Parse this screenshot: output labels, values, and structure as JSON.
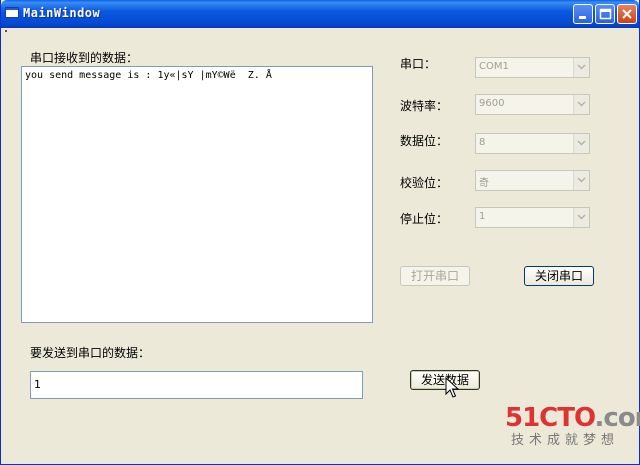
{
  "window": {
    "title": "MainWindow"
  },
  "receive": {
    "label": "串口接收到的数据：",
    "content": "you send message is : 1y«|sY |mY©Wë  Z. Å"
  },
  "send": {
    "label": "要发送到串口的数据：",
    "value": "1",
    "button": "发送数据"
  },
  "settings": [
    {
      "label": "串口：",
      "value": "COM1"
    },
    {
      "label": "波特率：",
      "value": "9600"
    },
    {
      "label": "数据位：",
      "value": "8"
    },
    {
      "label": "校验位：",
      "value": "奇"
    },
    {
      "label": "停止位：",
      "value": "1"
    }
  ],
  "buttons": {
    "open": "打开串口",
    "close": "关闭串口"
  },
  "watermark": {
    "brand_prefix": "51CTO",
    "brand_suffix": ".com",
    "slogan": "技术成就梦想"
  },
  "colors": {
    "titlebar": "#0448d0",
    "window_bg": "#ece9d8",
    "watermark_red": "#dd3333"
  },
  "icons": [
    "app-icon",
    "minimize-icon",
    "maximize-icon",
    "close-icon",
    "chevron-down-icon",
    "mouse-cursor-icon"
  ]
}
